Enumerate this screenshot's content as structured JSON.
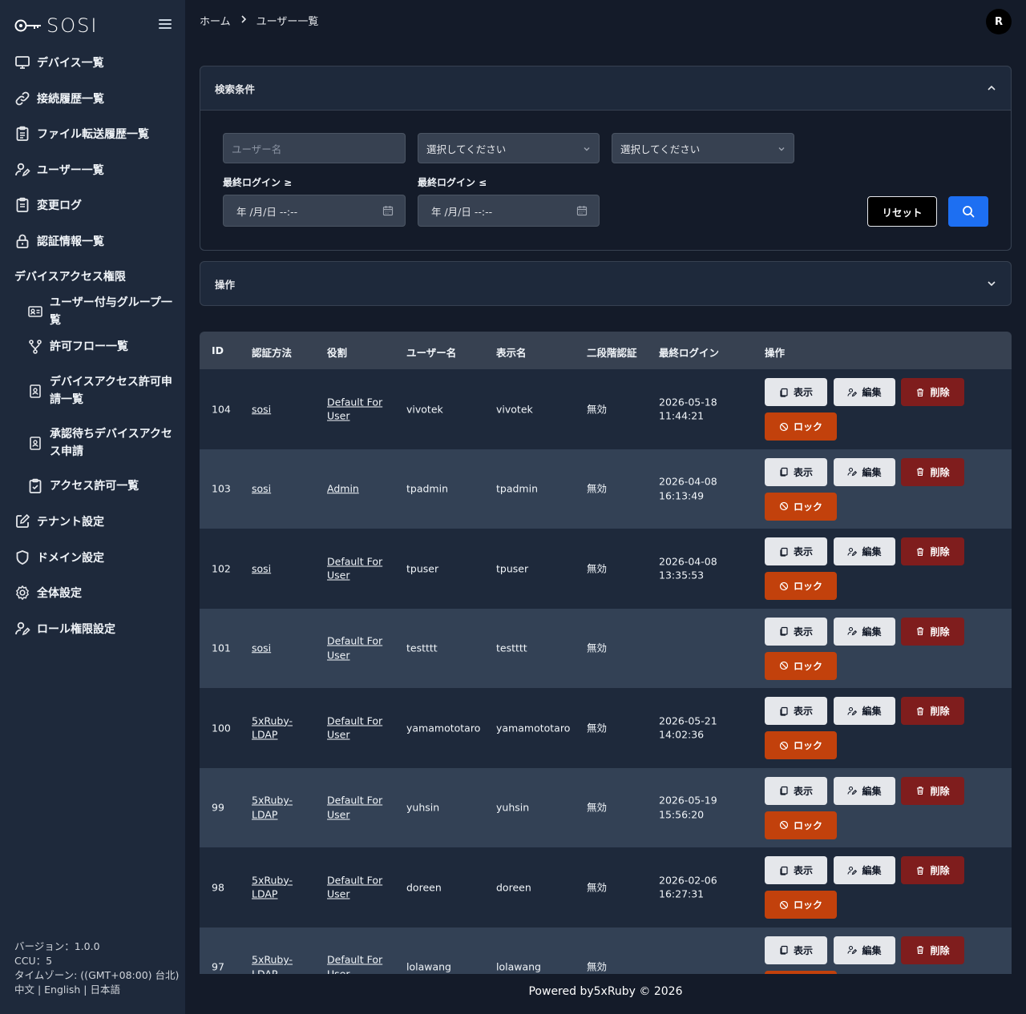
{
  "app": {
    "logo_text": "SOSI"
  },
  "sidebar": {
    "items": [
      {
        "label": "デバイス一覧",
        "icon": "monitor-icon"
      },
      {
        "label": "接続履歴一覧",
        "icon": "link-icon"
      },
      {
        "label": "ファイル転送履歴一覧",
        "icon": "clipboard-list-icon"
      },
      {
        "label": "ユーザー一覧",
        "icon": "user-edit-icon"
      },
      {
        "label": "変更ログ",
        "icon": "clipboard-icon"
      },
      {
        "label": "認証情報一覧",
        "icon": "lock-icon"
      }
    ],
    "section_label": "デバイスアクセス権限",
    "sub_items": [
      {
        "label": "ユーザー付与グループ一覧",
        "icon": "id-card-icon"
      },
      {
        "label": "許可フロー一覧",
        "icon": "git-branch-icon"
      },
      {
        "label": "デバイスアクセス許可申請一覧",
        "icon": "badge-icon"
      },
      {
        "label": "承認待ちデバイスアクセス申請",
        "icon": "badge-icon"
      },
      {
        "label": "アクセス許可一覧",
        "icon": "clipboard-check-icon"
      }
    ],
    "bottom_items": [
      {
        "label": "テナント設定",
        "icon": "edit-icon"
      },
      {
        "label": "ドメイン設定",
        "icon": "shield-icon"
      },
      {
        "label": "全体設定",
        "icon": "gear-icon"
      },
      {
        "label": "ロール権限設定",
        "icon": "user-edit-icon"
      }
    ],
    "footer": {
      "version": "バージョン：1.0.0",
      "ccu": "CCU：5",
      "timezone": "タイムゾーン: ((GMT+08:00) 台北)",
      "languages": "中文 | English | 日本語"
    }
  },
  "header": {
    "breadcrumb": [
      "ホーム",
      "ユーザー一覧"
    ],
    "avatar_initial": "R"
  },
  "search": {
    "title": "検索条件",
    "username_placeholder": "ユーザー名",
    "select1": "選択してください",
    "select2": "選択してください",
    "last_login_from_label": "最終ログイン ≥",
    "last_login_to_label": "最終ログイン ≤",
    "date_placeholder": "年 /月/日 --:--",
    "reset_label": "リセット"
  },
  "operations": {
    "title": "操作"
  },
  "table": {
    "columns": [
      "ID",
      "認証方法",
      "役割",
      "ユーザー名",
      "表示名",
      "二段階認証",
      "最終ログイン",
      "操作"
    ],
    "actions": {
      "show": "表示",
      "edit": "編集",
      "delete": "削除",
      "lock": "ロック"
    },
    "rows": [
      {
        "id": "104",
        "auth": [
          "sosi"
        ],
        "role": [
          "Default For",
          "User"
        ],
        "username": "vivotek",
        "display": "vivotek",
        "twofa": "無効",
        "last_login": [
          "2026-05-18",
          "11:44:21"
        ]
      },
      {
        "id": "103",
        "auth": [
          "sosi"
        ],
        "role": [
          "Admin"
        ],
        "username": "tpadmin",
        "display": "tpadmin",
        "twofa": "無効",
        "last_login": [
          "2026-04-08",
          "16:13:49"
        ]
      },
      {
        "id": "102",
        "auth": [
          "sosi"
        ],
        "role": [
          "Default For",
          "User"
        ],
        "username": "tpuser",
        "display": "tpuser",
        "twofa": "無効",
        "last_login": [
          "2026-04-08",
          "13:35:53"
        ]
      },
      {
        "id": "101",
        "auth": [
          "sosi"
        ],
        "role": [
          "Default For",
          "User"
        ],
        "username": "testttt",
        "display": "testttt",
        "twofa": "無効",
        "last_login": []
      },
      {
        "id": "100",
        "auth": [
          "5xRuby-",
          "LDAP"
        ],
        "role": [
          "Default For",
          "User"
        ],
        "username": "yamamototaro",
        "display": "yamamototaro",
        "twofa": "無効",
        "last_login": [
          "2026-05-21",
          "14:02:36"
        ]
      },
      {
        "id": "99",
        "auth": [
          "5xRuby-",
          "LDAP"
        ],
        "role": [
          "Default For",
          "User"
        ],
        "username": "yuhsin",
        "display": "yuhsin",
        "twofa": "無効",
        "last_login": [
          "2026-05-19",
          "15:56:20"
        ]
      },
      {
        "id": "98",
        "auth": [
          "5xRuby-",
          "LDAP"
        ],
        "role": [
          "Default For",
          "User"
        ],
        "username": "doreen",
        "display": "doreen",
        "twofa": "無効",
        "last_login": [
          "2026-02-06",
          "16:27:31"
        ]
      },
      {
        "id": "97",
        "auth": [
          "5xRuby-",
          "LDAP"
        ],
        "role": [
          "Default For",
          "User"
        ],
        "username": "lolawang",
        "display": "lolawang",
        "twofa": "無効",
        "last_login": []
      }
    ]
  },
  "footer": {
    "text": "Powered by5xRuby © 2026"
  }
}
